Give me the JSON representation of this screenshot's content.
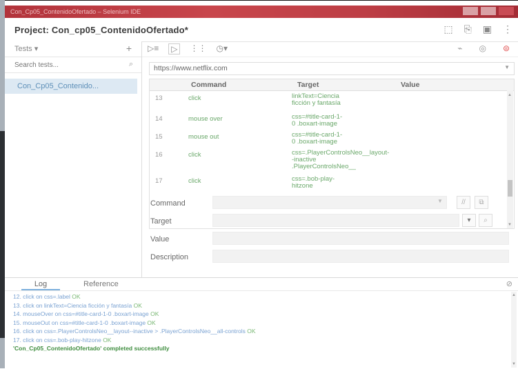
{
  "window": {
    "title": "Con_Cp05_ContenidoOfertado – Selenium IDE"
  },
  "project": {
    "title": "Project:  Con_cp05_ContenidoOfertado*",
    "icons": [
      "folder-icon",
      "open-icon",
      "save-icon",
      "more-icon"
    ]
  },
  "sidebar": {
    "tests_label": "Tests",
    "add_label": "+",
    "search_placeholder": "Search tests...",
    "items": [
      {
        "label": "Con_Cp05_Contenido..."
      }
    ]
  },
  "toolbar": {
    "run_all": "▷≡",
    "run": "▷",
    "step": "⋮⋮",
    "speed": "◷▾",
    "disable_breakpoints": "⌁",
    "pause": "◎",
    "record": "⊜"
  },
  "url": {
    "value": "https://www.netflix.com"
  },
  "table": {
    "headers": {
      "command": "Command",
      "target": "Target",
      "value": "Value"
    },
    "rows": [
      {
        "num": "13",
        "command": "click",
        "target": "linkText=Ciencia ficción y fantasía",
        "value": ""
      },
      {
        "num": "14",
        "command": "mouse over",
        "target": "css=#title-card-1-0 .boxart-image",
        "value": ""
      },
      {
        "num": "15",
        "command": "mouse out",
        "target": "css=#title-card-1-0 .boxart-image",
        "value": ""
      },
      {
        "num": "16",
        "command": "click",
        "target": "css=.PlayerControlsNeo__layout--inactive .PlayerControlsNeo__",
        "value": ""
      },
      {
        "num": "17",
        "command": "click",
        "target": "css=.bob-play-hitzone",
        "value": ""
      }
    ]
  },
  "form": {
    "command_label": "Command",
    "target_label": "Target",
    "value_label": "Value",
    "description_label": "Description",
    "command_value": "",
    "target_value": "",
    "value_value": "",
    "description_value": ""
  },
  "log": {
    "tabs": {
      "log": "Log",
      "reference": "Reference"
    },
    "lines": [
      {
        "text": "12. click on css=.label",
        "status": "OK"
      },
      {
        "text": "13. click on linkText=Ciencia ficción y fantasía",
        "status": "OK"
      },
      {
        "text": "14. mouseOver on css=#title-card-1-0 .boxart-image",
        "status": "OK"
      },
      {
        "text": "15. mouseOut on css=#title-card-1-0 .boxart-image",
        "status": "OK"
      },
      {
        "text": "16. click on css=.PlayerControlsNeo__layout--inactive > .PlayerControlsNeo__all-controls",
        "status": "OK"
      },
      {
        "text": "17. click on css=.bob-play-hitzone",
        "status": "OK"
      }
    ],
    "completed": "'Con_Cp05_ContenidoOfertado' completed successfully"
  },
  "colors": {
    "titlebar": "#c8464c",
    "selection": "#dde9f3",
    "log_link": "#7aa2d2",
    "ok_green": "#7ab874",
    "success_green": "#3f8d3f"
  }
}
